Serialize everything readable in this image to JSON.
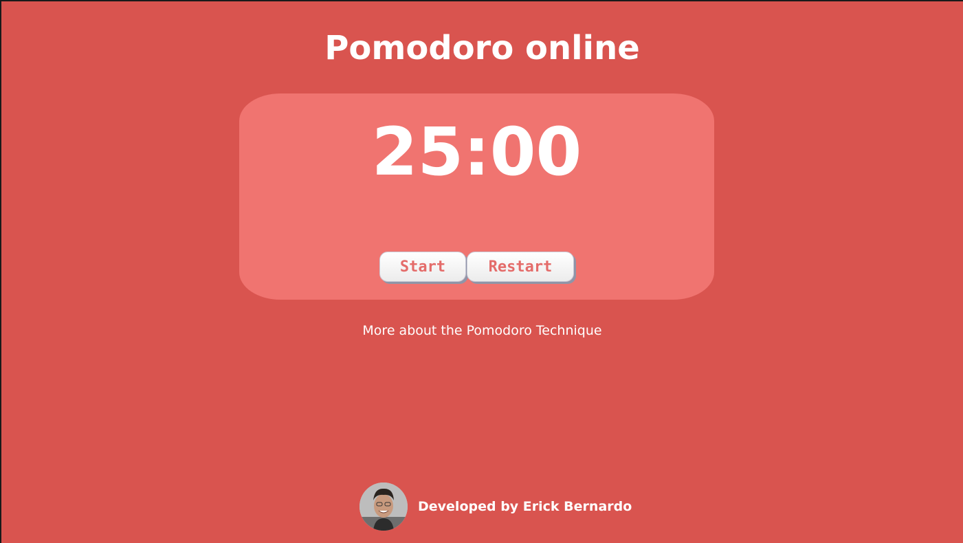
{
  "header": {
    "title": "Pomodoro online"
  },
  "timer": {
    "display": "25:00",
    "start_label": "Start",
    "restart_label": "Restart"
  },
  "links": {
    "more_about": "More about the Pomodoro Technique"
  },
  "footer": {
    "credit": "Developed by Erick Bernardo",
    "avatar_icon": "developer-photo"
  },
  "colors": {
    "background": "#d9544f",
    "card": "#f07470",
    "button_text": "#e46c6a",
    "text": "#ffffff"
  }
}
